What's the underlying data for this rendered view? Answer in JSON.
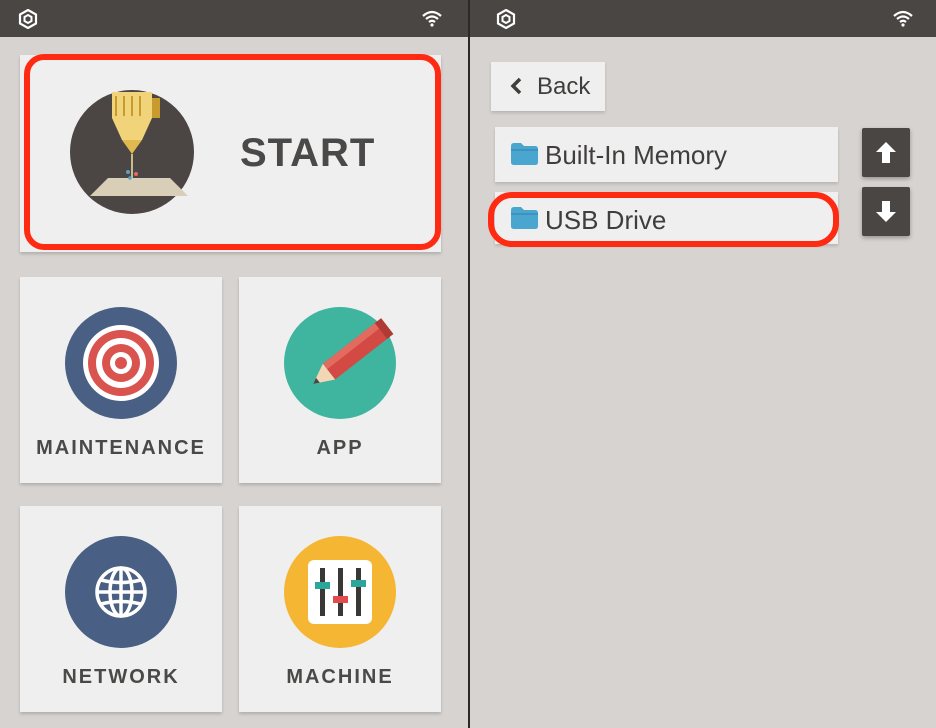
{
  "left_panel": {
    "start": {
      "label": "START",
      "icon": "3d-printer-nozzle-icon"
    },
    "tiles": [
      {
        "label": "MAINTENANCE",
        "icon": "target-icon"
      },
      {
        "label": "APP",
        "icon": "pencil-icon"
      },
      {
        "label": "NETWORK",
        "icon": "globe-icon"
      },
      {
        "label": "MACHINE",
        "icon": "sliders-icon"
      }
    ]
  },
  "right_panel": {
    "back": {
      "label": "Back",
      "icon": "chevron-left-icon"
    },
    "storage_items": [
      {
        "label": "Built-In Memory",
        "icon": "folder-icon"
      },
      {
        "label": "USB Drive",
        "icon": "folder-icon"
      }
    ],
    "scroll_controls": {
      "up_icon": "arrow-up-icon",
      "down_icon": "arrow-down-icon"
    }
  },
  "status_bar": {
    "logo_icon": "brand-logo-icon",
    "wifi_icon": "wifi-icon"
  },
  "colors": {
    "status_bar": "#4a4644",
    "tile_bg": "#efefef",
    "panel_bg": "#d7d3d0",
    "highlight": "#ff2a12",
    "folder": "#4aa6cf",
    "start_icon_bg": "#4b4643",
    "maintenance_icon_bg": "#4a5f84",
    "app_icon_bg": "#3fb5a0",
    "network_icon_bg": "#4a5f84",
    "machine_icon_bg": "#f4b633"
  }
}
